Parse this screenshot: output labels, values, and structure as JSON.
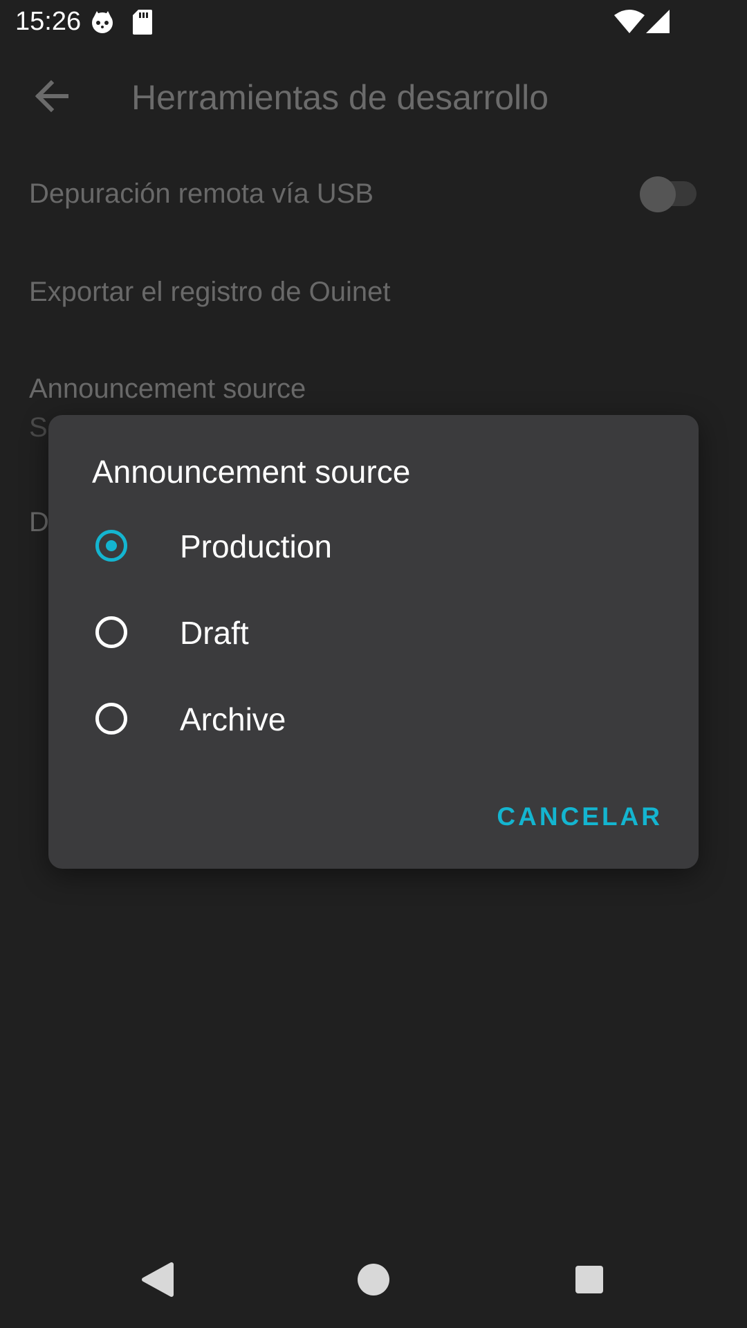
{
  "status_bar": {
    "time": "15:26"
  },
  "app_bar": {
    "title": "Herramientas de desarrollo"
  },
  "settings": {
    "usb_debugging": "Depuración remota vía USB",
    "export_log": "Exportar el registro de Ouinet",
    "announcement_source": "Announcement source",
    "announcement_source_sub": "Se",
    "fourth_item": "D"
  },
  "dialog": {
    "title": "Announcement source",
    "options": [
      {
        "label": "Production",
        "checked": true
      },
      {
        "label": "Draft",
        "checked": false
      },
      {
        "label": "Archive",
        "checked": false
      }
    ],
    "cancel_label": "CANCELAR"
  },
  "colors": {
    "accent": "#14b5d0",
    "background": "#202020",
    "dialog": "#3b3b3d"
  }
}
